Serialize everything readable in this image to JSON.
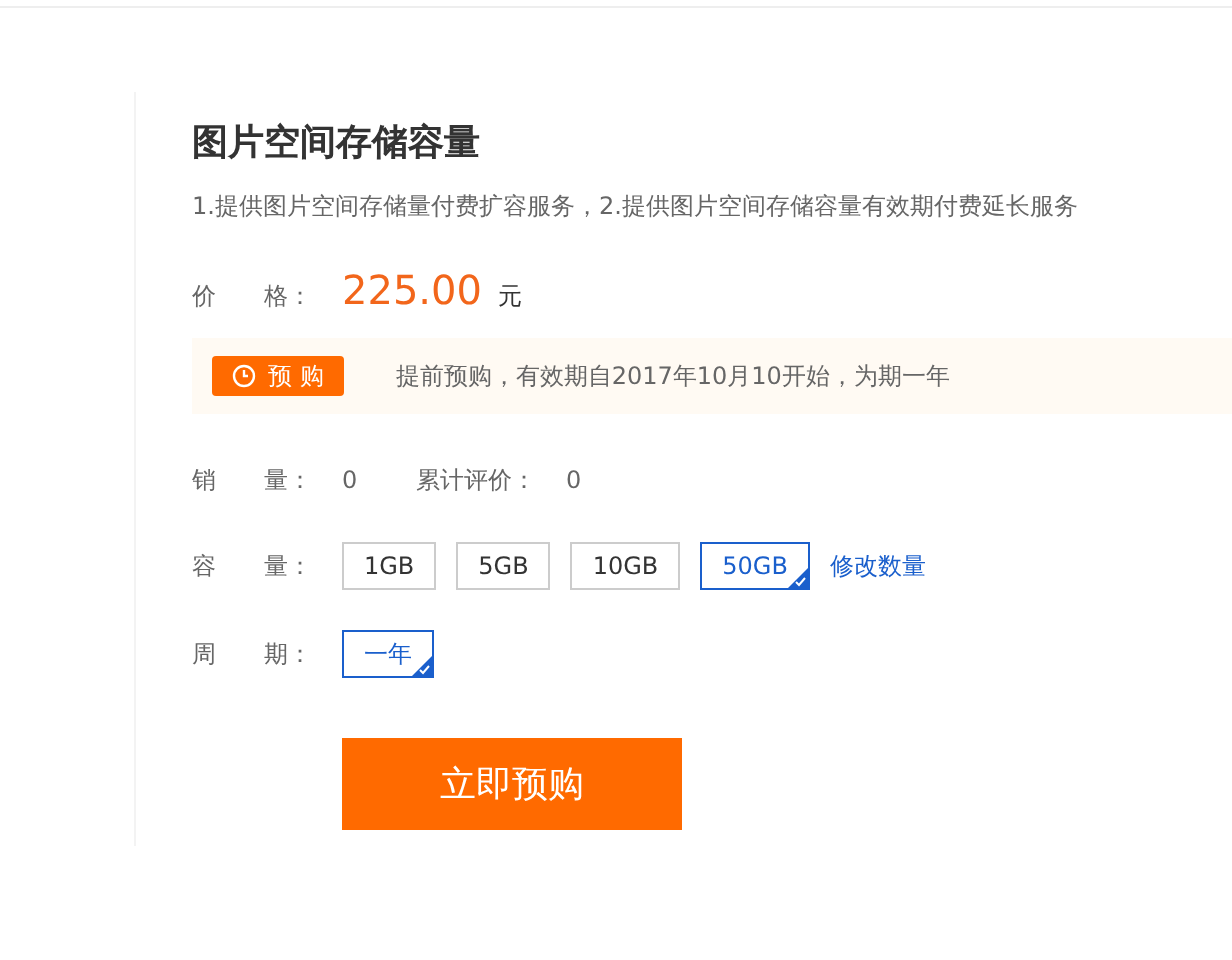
{
  "title": "图片空间存储容量",
  "description": "1.提供图片空间存储量付费扩容服务，2.提供图片空间存储容量有效期付费延长服务",
  "price": {
    "label": "价　　格：",
    "amount": "225.00",
    "unit": "元"
  },
  "presale": {
    "badge": "预 购",
    "text": "提前预购，有效期自2017年10月10开始，为期一年"
  },
  "stats": [
    {
      "label": "销　　量：",
      "value": "0"
    },
    {
      "label": "累计评价：",
      "value": "0"
    }
  ],
  "capacity": {
    "label": "容　　量：",
    "options": [
      {
        "label": "1GB",
        "selected": false
      },
      {
        "label": "5GB",
        "selected": false
      },
      {
        "label": "10GB",
        "selected": false
      },
      {
        "label": "50GB",
        "selected": true
      }
    ],
    "link": "修改数量"
  },
  "period": {
    "label": "周　　期：",
    "options": [
      {
        "label": "一年",
        "selected": true
      }
    ]
  },
  "buy_button": "立即预购"
}
